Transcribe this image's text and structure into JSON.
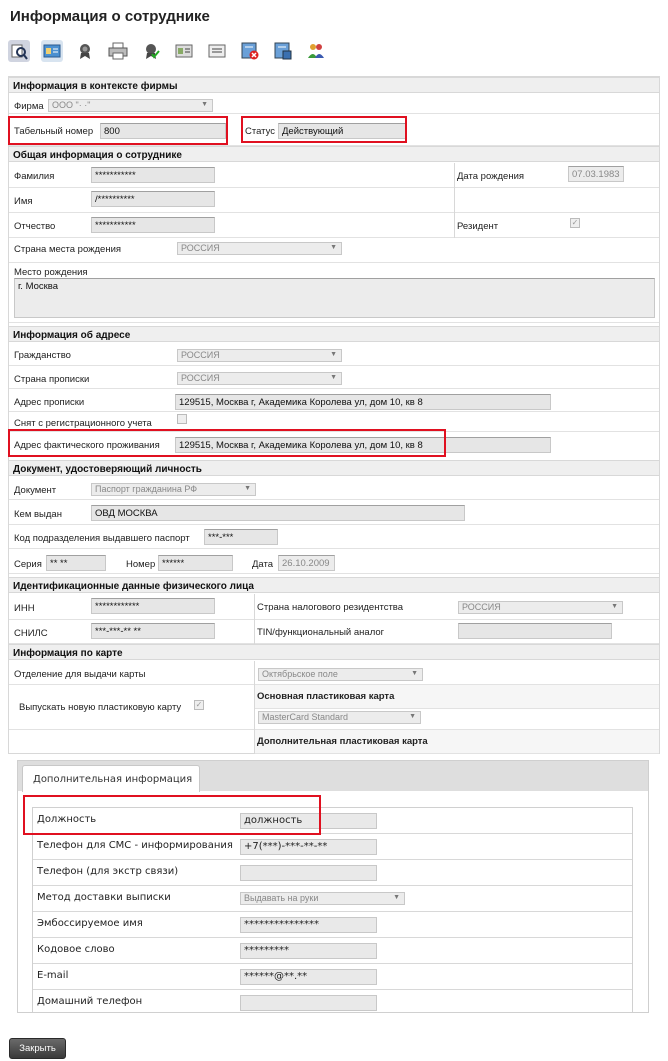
{
  "title": "Информация о сотруднике",
  "toolbar": {
    "icons": [
      "search-doc-icon",
      "id-card-icon",
      "award-icon",
      "printer-icon",
      "award-check-icon",
      "id-card-2-icon",
      "document-icon",
      "delete-doc-icon",
      "doc-save-icon",
      "users-icon"
    ]
  },
  "firm": {
    "section": "Информация в контексте фирмы",
    "label": "Фирма",
    "value": "ООО \"·          ·\"",
    "tab_label": "Табельный номер",
    "tab_value": "800",
    "status_label": "Статус",
    "status_value": "Действующий"
  },
  "general": {
    "section": "Общая информация о сотруднике",
    "surname_label": "Фамилия",
    "surname_value": "***********",
    "name_label": "Имя",
    "name_value": "/**********",
    "patronymic_label": "Отчество",
    "patronymic_value": "***********",
    "birth_label": "Дата рождения",
    "birth_value": "07.03.1983",
    "resident_label": "Резидент",
    "birth_country_label": "Страна места рождения",
    "birth_country_value": "РОССИЯ",
    "birth_place_label": "Место рождения",
    "birth_place_value": "г. Москва"
  },
  "address": {
    "section": "Информация об адресе",
    "citizenship_label": "Гражданство",
    "citizenship_value": "РОССИЯ",
    "reg_country_label": "Страна прописки",
    "reg_country_value": "РОССИЯ",
    "reg_address_label": "Адрес прописки",
    "reg_address_value": "129515, Москва г, Академика Королева ул, дом 10, кв 8",
    "deregistered_label": "Снят с регистрационного учета",
    "actual_address_label": "Адрес фактического проживания",
    "actual_address_value": "129515, Москва г, Академика Королева ул, дом 10, кв 8"
  },
  "document": {
    "section": "Документ, удостоверяющий личность",
    "doc_label": "Документ",
    "doc_value": "Паспорт гражданина РФ",
    "issued_label": "Кем выдан",
    "issued_value": "ОВД МОСКВА",
    "dept_code_label": "Код подразделения выдавшего паспорт",
    "dept_code_value": "***-***",
    "series_label": "Серия",
    "series_value": "** **",
    "number_label": "Номер",
    "number_value": "******",
    "date_label": "Дата",
    "date_value": "26.10.2009"
  },
  "ident": {
    "section": "Идентификационные данные физического лица",
    "inn_label": "ИНН",
    "inn_value": "************",
    "snils_label": "СНИЛС",
    "snils_value": "***-***-** **",
    "tax_country_label": "Страна налогового резидентства",
    "tax_country_value": "РОССИЯ",
    "tin_label": "TIN/функциональный аналог",
    "tin_value": ""
  },
  "card": {
    "section": "Информация по карте",
    "branch_label": "Отделение для выдачи карты",
    "branch_value": "Октябрьское поле",
    "issue_new_label": "Выпускать новую пластиковую карту",
    "main_card_label": "Основная пластиковая карта",
    "main_card_value": "MasterCard Standard",
    "extra_card_label": "Дополнительная пластиковая карта"
  },
  "extra": {
    "tab_label": "Дополнительная информация",
    "rows": [
      {
        "label": "Должность",
        "value": "должность"
      },
      {
        "label": "Телефон для СМС - информирования",
        "value": "+7(***)-***-**-**"
      },
      {
        "label": "Телефон (для экстр связи)",
        "value": ""
      },
      {
        "label": "Метод доставки выписки",
        "value": "Выдавать на руки"
      },
      {
        "label": "Эмбоссируемое имя",
        "value": "***************"
      },
      {
        "label": "Кодовое слово",
        "value": "*********"
      },
      {
        "label": "E-mail",
        "value": "******@**.**"
      },
      {
        "label": "Домашний телефон",
        "value": ""
      }
    ]
  },
  "close_button": "Закрыть",
  "colors": {
    "highlight": "#e01020",
    "section_bg": "#efefef"
  }
}
